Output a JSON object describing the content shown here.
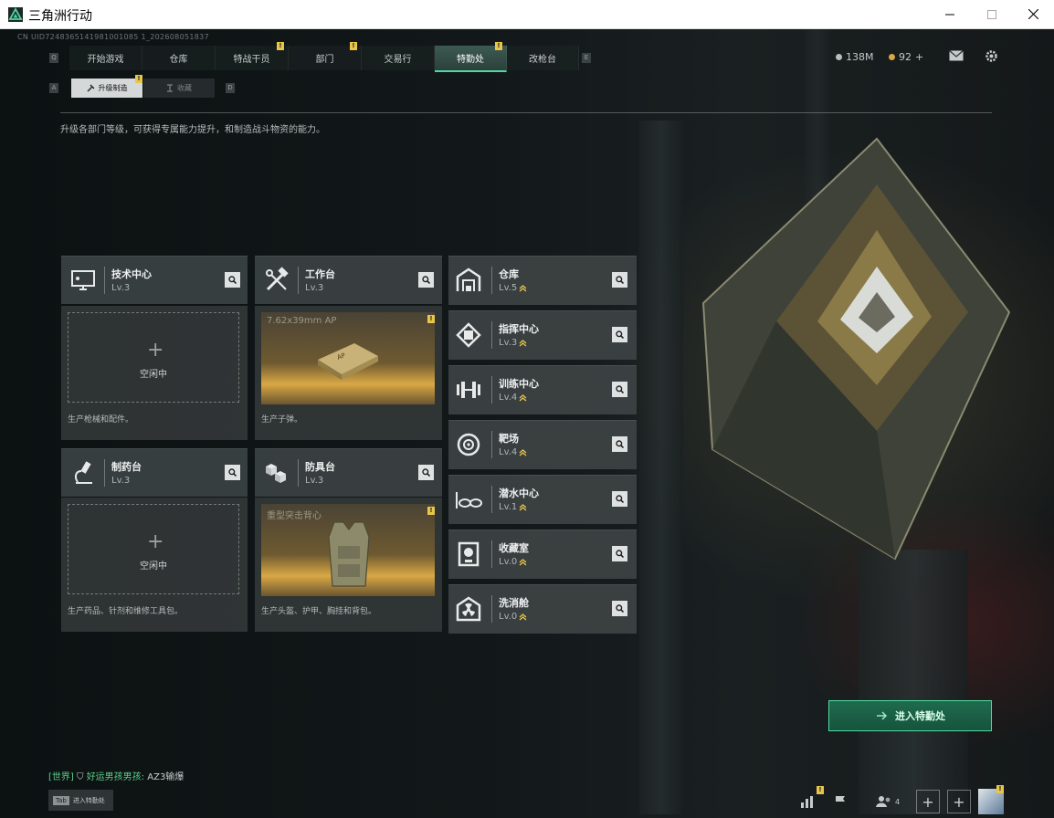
{
  "window": {
    "title": "三角洲行动",
    "accent_color": "#52d6a0"
  },
  "uid_text": "CN UID7248365141981001085 1_202608051837",
  "nav": {
    "left_key": "Q",
    "right_key": "E",
    "tabs": [
      {
        "label": "开始游戏",
        "badge": ""
      },
      {
        "label": "仓库",
        "badge": ""
      },
      {
        "label": "特战干员",
        "badge": "!"
      },
      {
        "label": "部门",
        "badge": "!"
      },
      {
        "label": "交易行",
        "badge": ""
      },
      {
        "label": "特勤处",
        "badge": "!",
        "active": true
      },
      {
        "label": "改枪台",
        "badge": ""
      }
    ]
  },
  "currency": {
    "coins": "138M",
    "tickets": "92",
    "add_symbol": "+"
  },
  "subnav": {
    "left_key": "A",
    "right_key": "D",
    "tabs": [
      {
        "label": "升级制造",
        "active": true,
        "badge": "!"
      },
      {
        "label": "收藏",
        "active": false
      }
    ]
  },
  "description": "升级各部门等级，可获得专属能力提升，和制造战斗物资的能力。",
  "workshops": [
    {
      "title": "技术中心",
      "level": "Lv.3",
      "state": "empty",
      "slot_label": "空闲中",
      "footer": "生产枪械和配件。"
    },
    {
      "title": "工作台",
      "level": "Lv.3",
      "state": "producing",
      "product": "7.62x39mm AP",
      "badge": "!",
      "footer": "生产子弹。"
    },
    {
      "title": "制药台",
      "level": "Lv.3",
      "state": "empty",
      "slot_label": "空闲中",
      "footer": "生产药品、针剂和维修工具包。"
    },
    {
      "title": "防具台",
      "level": "Lv.3",
      "state": "producing",
      "product": "重型突击背心",
      "badge": "!",
      "footer": "生产头盔、护甲、胸挂和背包。"
    }
  ],
  "facilities": [
    {
      "title": "仓库",
      "level": "Lv.5",
      "icon": "warehouse-icon"
    },
    {
      "title": "指挥中心",
      "level": "Lv.3",
      "icon": "chip-icon"
    },
    {
      "title": "训练中心",
      "level": "Lv.4",
      "icon": "dumbbell-icon"
    },
    {
      "title": "靶场",
      "level": "Lv.4",
      "icon": "target-icon"
    },
    {
      "title": "潜水中心",
      "level": "Lv.1",
      "icon": "goggles-icon"
    },
    {
      "title": "收藏室",
      "level": "Lv.0",
      "icon": "trophy-icon"
    },
    {
      "title": "洗消舱",
      "level": "Lv.0",
      "icon": "radiation-icon"
    }
  ],
  "enter_button": "进入特勤处",
  "chat": {
    "channel": "[世界]",
    "sender": "好运男孩男孩:",
    "message": "AZ3输爆"
  },
  "tab_hint": {
    "key": "Tab",
    "label": "进入特勤处"
  },
  "bottom_bar": {
    "friends_count": "4",
    "badge": "!"
  }
}
